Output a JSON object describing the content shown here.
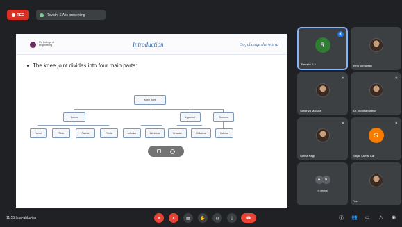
{
  "topbar": {
    "rec_label": "REC",
    "presenting": "Revathi S A is presenting"
  },
  "slide": {
    "logo_text": "RV College of Engineering",
    "title": "Introduction",
    "tagline": "Go, change the world",
    "bullet": "The knee joint divides into four main parts:",
    "root": "Knee Joint",
    "level1": [
      "Bones",
      "Ligament",
      "Tendons"
    ],
    "bones": [
      "Femur",
      "Tibia",
      "Patella",
      "Fibula"
    ],
    "middle_group": [
      "Articular",
      "Meniscus"
    ],
    "ligaments": [
      "Cruciate",
      "Collateral"
    ],
    "tendons": [
      "Patellar"
    ]
  },
  "participants": [
    {
      "name": "Revathi S A",
      "initial": "R",
      "color": "#2e7d32",
      "speaking": true
    },
    {
      "name": "renu kumaresh",
      "photo": true
    },
    {
      "name": "Sandhya Madura",
      "photo": true
    },
    {
      "name": "Dr. Monika Mathur",
      "photo": true
    },
    {
      "name": "Sahna Nagi",
      "photo": true
    },
    {
      "name": "Sajan Kumar Kar",
      "initial": "S",
      "color": "#f57c00"
    },
    {
      "others_initials": [
        "A",
        "N"
      ],
      "others_label": "9 others"
    },
    {
      "name": "You",
      "photo": true
    }
  ],
  "bottombar": {
    "meeting_info": "11:55 | pai-ahkp-fra"
  },
  "colors": {
    "accent": "#8ab4f8",
    "red": "#ea4335",
    "tile_bg": "#3c4043",
    "background": "#202124"
  }
}
